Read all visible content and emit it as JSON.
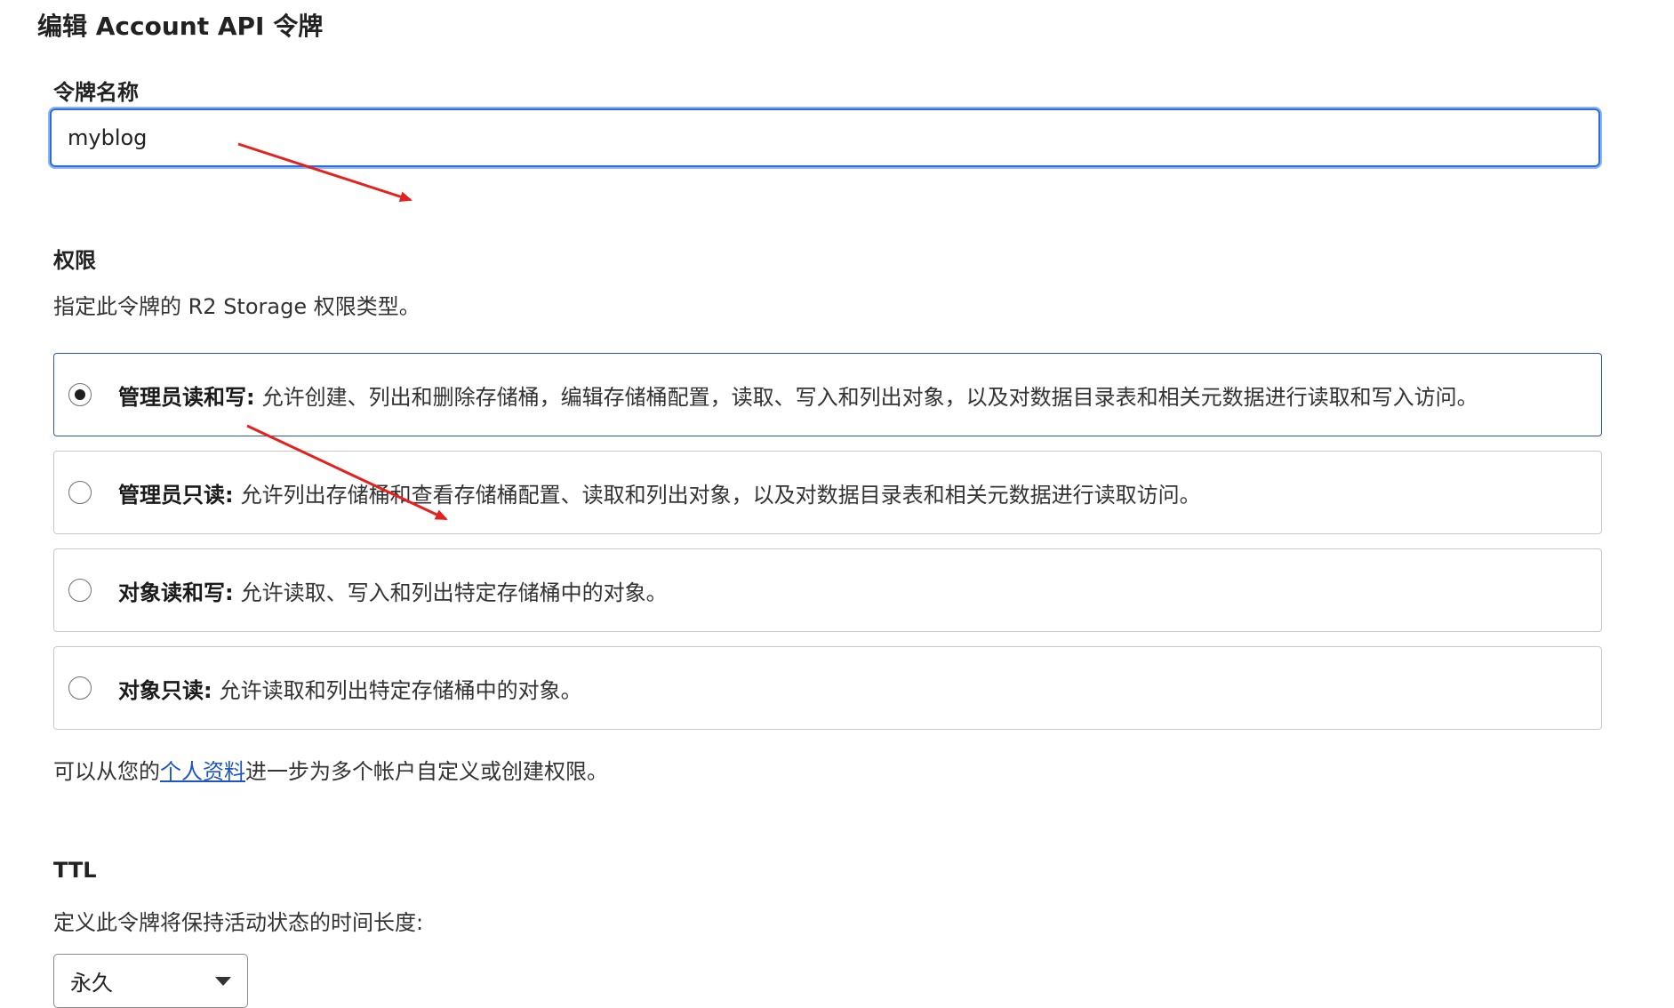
{
  "page": {
    "title": "编辑 Account API 令牌"
  },
  "token_name": {
    "label": "令牌名称",
    "value": "myblog"
  },
  "permissions": {
    "label": "权限",
    "description": "指定此令牌的 R2 Storage 权限类型。",
    "options": [
      {
        "title": "管理员读和写:",
        "description": "允许创建、列出和删除存储桶，编辑存储桶配置，读取、写入和列出对象，以及对数据目录表和相关元数据进行读取和写入访问。",
        "selected": true
      },
      {
        "title": "管理员只读:",
        "description": "允许列出存储桶和查看存储桶配置、读取和列出对象，以及对数据目录表和相关元数据进行读取访问。",
        "selected": false
      },
      {
        "title": "对象读和写:",
        "description": "允许读取、写入和列出特定存储桶中的对象。",
        "selected": false
      },
      {
        "title": "对象只读:",
        "description": "允许读取和列出特定存储桶中的对象。",
        "selected": false
      }
    ],
    "footer_prefix": "可以从您的",
    "footer_link": "个人资料",
    "footer_suffix": "进一步为多个帐户自定义或创建权限。"
  },
  "ttl": {
    "label": "TTL",
    "description": "定义此令牌将保持活动状态的时间长度:",
    "selected": "永久"
  },
  "annotation_color": "#e5211d",
  "colors": {
    "focus_border": "#2d6cdf",
    "link": "#1d55c6"
  }
}
